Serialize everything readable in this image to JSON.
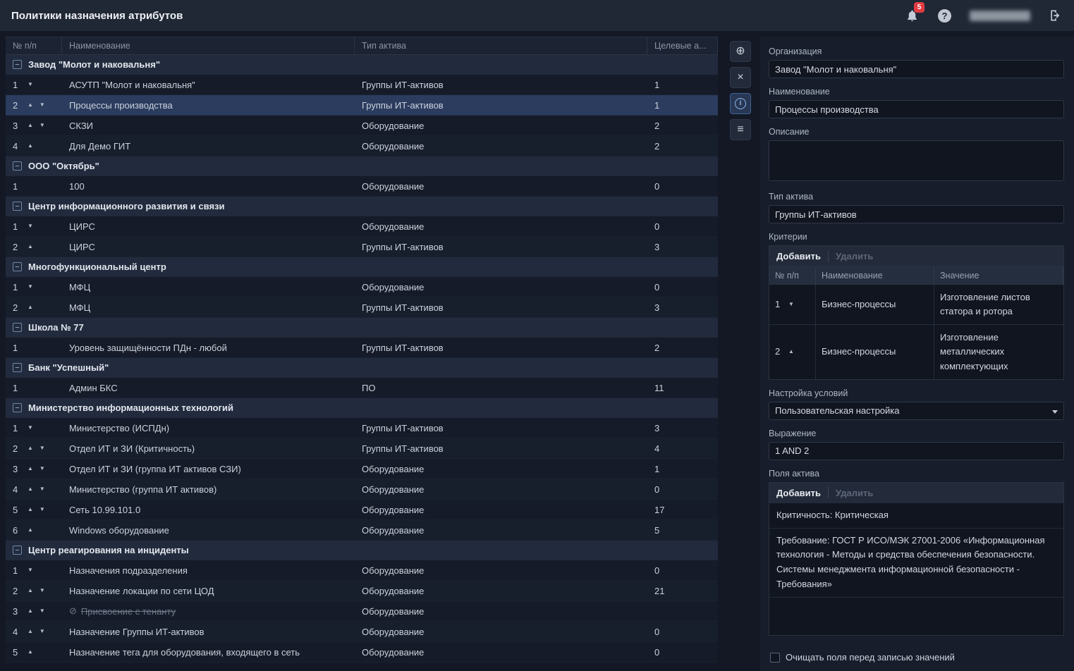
{
  "header": {
    "title": "Политики назначения атрибутов",
    "notification_count": "5",
    "help_glyph": "?"
  },
  "left_table": {
    "columns": {
      "num": "№ п/п",
      "name": "Наименование",
      "asset_type": "Тип актива",
      "targets": "Целевые а..."
    },
    "groups": [
      {
        "name": "Завод \"Молот и наковальня\"",
        "rows": [
          {
            "num": "1",
            "arrows": "down",
            "name": "АСУТП \"Молот и наковальня\"",
            "asset_type": "Группы ИТ-активов",
            "targets": "1"
          },
          {
            "num": "2",
            "arrows": "both",
            "name": "Процессы производства",
            "asset_type": "Группы ИТ-активов",
            "targets": "1",
            "selected": true
          },
          {
            "num": "3",
            "arrows": "both",
            "name": "СКЗИ",
            "asset_type": "Оборудование",
            "targets": "2"
          },
          {
            "num": "4",
            "arrows": "up",
            "name": "Для Демо ГИТ",
            "asset_type": "Оборудование",
            "targets": "2"
          }
        ]
      },
      {
        "name": "ООО \"Октябрь\"",
        "rows": [
          {
            "num": "1",
            "arrows": "none",
            "name": "100",
            "asset_type": "Оборудование",
            "targets": "0"
          }
        ]
      },
      {
        "name": "Центр информационного развития и связи",
        "rows": [
          {
            "num": "1",
            "arrows": "down",
            "name": "ЦИРС",
            "asset_type": "Оборудование",
            "targets": "0"
          },
          {
            "num": "2",
            "arrows": "up",
            "name": "ЦИРС",
            "asset_type": "Группы ИТ-активов",
            "targets": "3"
          }
        ]
      },
      {
        "name": "Многофункциональный центр",
        "rows": [
          {
            "num": "1",
            "arrows": "down",
            "name": "МФЦ",
            "asset_type": "Оборудование",
            "targets": "0"
          },
          {
            "num": "2",
            "arrows": "up",
            "name": "МФЦ",
            "asset_type": "Группы ИТ-активов",
            "targets": "3"
          }
        ]
      },
      {
        "name": "Школа № 77",
        "rows": [
          {
            "num": "1",
            "arrows": "none",
            "name": "Уровень защищённости ПДн - любой",
            "asset_type": "Группы ИТ-активов",
            "targets": "2"
          }
        ]
      },
      {
        "name": "Банк \"Успешный\"",
        "rows": [
          {
            "num": "1",
            "arrows": "none",
            "name": "Админ БКС",
            "asset_type": "ПО",
            "targets": "11"
          }
        ]
      },
      {
        "name": "Министерство информационных технологий",
        "rows": [
          {
            "num": "1",
            "arrows": "down",
            "name": "Министерство (ИСПДн)",
            "asset_type": "Группы ИТ-активов",
            "targets": "3"
          },
          {
            "num": "2",
            "arrows": "both",
            "name": "Отдел ИТ и ЗИ (Критичность)",
            "asset_type": "Группы ИТ-активов",
            "targets": "4"
          },
          {
            "num": "3",
            "arrows": "both",
            "name": "Отдел ИТ и ЗИ (группа ИТ активов СЗИ)",
            "asset_type": "Оборудование",
            "targets": "1"
          },
          {
            "num": "4",
            "arrows": "both",
            "name": "Министерство (группа ИТ активов)",
            "asset_type": "Оборудование",
            "targets": "0"
          },
          {
            "num": "5",
            "arrows": "both",
            "name": "Сеть 10.99.101.0",
            "asset_type": "Оборудование",
            "targets": "17"
          },
          {
            "num": "6",
            "arrows": "up",
            "name": "Windows оборудование",
            "asset_type": "Оборудование",
            "targets": "5"
          }
        ]
      },
      {
        "name": "Центр реагирования на инциденты",
        "rows": [
          {
            "num": "1",
            "arrows": "down",
            "name": "Назначения подразделения",
            "asset_type": "Оборудование",
            "targets": "0"
          },
          {
            "num": "2",
            "arrows": "both",
            "name": "Назначение локации по сети ЦОД",
            "asset_type": "Оборудование",
            "targets": "21"
          },
          {
            "num": "3",
            "arrows": "both",
            "name": "Присвоение с тенанту",
            "asset_type": "Оборудование",
            "targets": "",
            "disabled": true
          },
          {
            "num": "4",
            "arrows": "both",
            "name": "Назначение Группы ИТ-активов",
            "asset_type": "Оборудование",
            "targets": "0"
          },
          {
            "num": "5",
            "arrows": "up",
            "name": "Назначение тега для оборудования, входящего в сеть",
            "asset_type": "Оборудование",
            "targets": "0"
          }
        ]
      }
    ]
  },
  "side_toolbar": {
    "buttons": [
      {
        "id": "add-policy",
        "glyph": "⊕",
        "active": false
      },
      {
        "id": "delete-policy",
        "glyph": "×",
        "active": false
      },
      {
        "id": "info",
        "glyph": "i",
        "active": true
      },
      {
        "id": "list-view",
        "glyph": "≡",
        "active": false
      }
    ]
  },
  "details": {
    "organization": {
      "label": "Организация",
      "value": "Завод \"Молот и наковальня\""
    },
    "name": {
      "label": "Наименование",
      "value": "Процессы производства"
    },
    "description": {
      "label": "Описание",
      "value": ""
    },
    "asset_type": {
      "label": "Тип актива",
      "value": "Группы ИТ-активов"
    },
    "criteria": {
      "label": "Критерии",
      "add_label": "Добавить",
      "delete_label": "Удалить",
      "columns": {
        "num": "№ п/п",
        "name": "Наименование",
        "value": "Значение"
      },
      "rows": [
        {
          "num": "1",
          "arrows": "down",
          "name": "Бизнес-процессы",
          "value": "Изготовление листов статора и ротора"
        },
        {
          "num": "2",
          "arrows": "up",
          "name": "Бизнес-процессы",
          "value": "Изготовление металлических комплектующих"
        }
      ]
    },
    "condition": {
      "label": "Настройка условий",
      "value": "Пользовательская настройка"
    },
    "expression": {
      "label": "Выражение",
      "value": "1 AND 2"
    },
    "asset_fields": {
      "label": "Поля актива",
      "add_label": "Добавить",
      "delete_label": "Удалить",
      "items": [
        "Критичность: Критическая",
        "Требование: ГОСТ Р ИСО/МЭК 27001-2006 «Информационная технология - Методы и средства обеспечения безопасности. Системы менеджмента информационной безопасности - Требования»"
      ]
    },
    "clear_checkbox_label": "Очищать поля перед записью значений"
  }
}
